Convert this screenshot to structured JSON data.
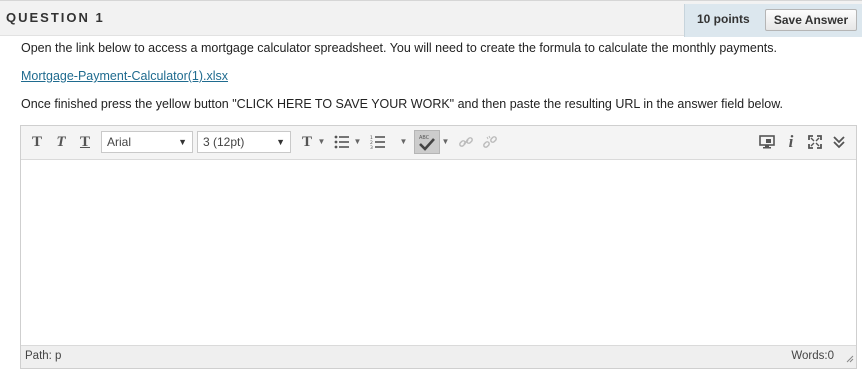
{
  "question": {
    "title": "QUESTION 1",
    "points": "10 points",
    "save_label": "Save Answer"
  },
  "instructions": {
    "line1": "Open the link below to access a mortgage calculator spreadsheet.  You will need to create the formula to calculate the monthly payments.",
    "link": "Mortgage-Payment-Calculator(1).xlsx",
    "line2": "Once finished press the yellow button \"CLICK HERE TO SAVE YOUR WORK\" and then paste the resulting URL in the answer field below."
  },
  "editor": {
    "toolbar": {
      "font_family": "Arial",
      "font_size": "3 (12pt)",
      "icons": [
        "bold-icon",
        "italic-icon",
        "underline-icon",
        "text-color-icon",
        "bullet-list-icon",
        "numbered-list-icon",
        "spellcheck-icon",
        "link-icon",
        "unlink-icon",
        "preview-icon",
        "info-icon",
        "fullscreen-icon",
        "collapse-icon"
      ],
      "spell_badge": "ABC"
    },
    "content": "",
    "path_label": "Path: p",
    "words_label": "Words:0"
  }
}
